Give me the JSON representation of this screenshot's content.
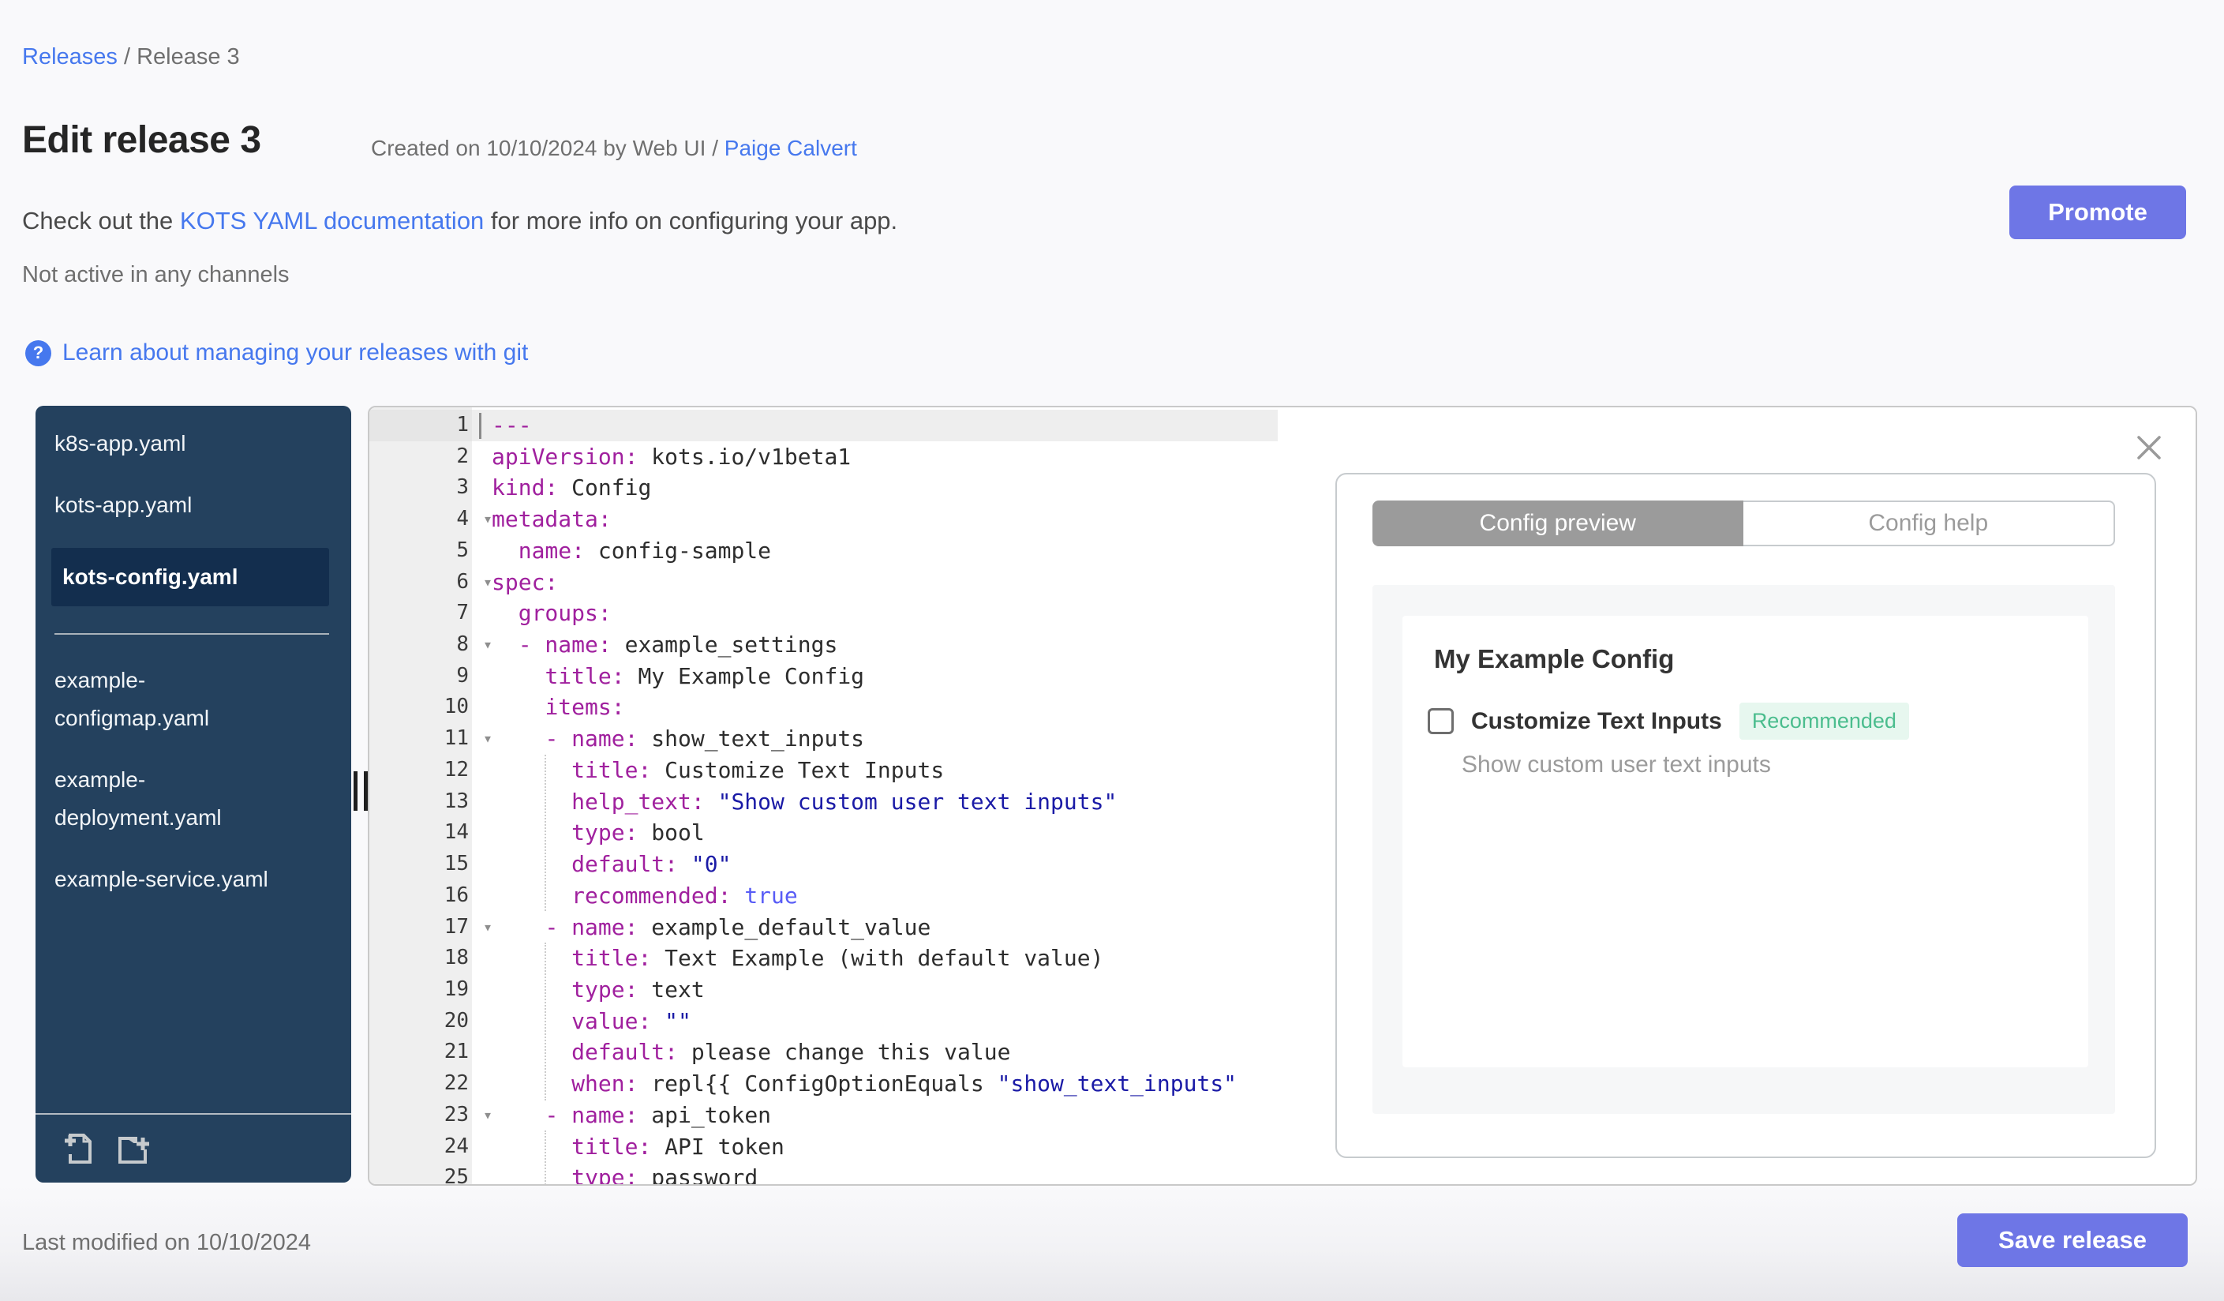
{
  "breadcrumb": {
    "link": "Releases",
    "separator": " / ",
    "current": "Release 3"
  },
  "header": {
    "title": "Edit release 3",
    "created_prefix": "Created on 10/10/2024 by Web UI / ",
    "created_author": "Paige Calvert",
    "docs_prefix": "Check out the ",
    "docs_link": "KOTS YAML documentation",
    "docs_suffix": " for more info on configuring your app.",
    "channel_status": "Not active in any channels",
    "git_link_label": "Learn about managing your releases with git",
    "promote_label": "Promote"
  },
  "icons": {
    "help": "question-mark-circle",
    "close": "x",
    "new_file": "file-plus",
    "new_folder": "folder-plus",
    "fold": "chevron-down",
    "drag_handle": "vertical-bars",
    "question_glyph": "?",
    "fold_glyph": "▾"
  },
  "colors": {
    "accent_button": "#6e76e6",
    "link_blue": "#4678ee",
    "sidebar_bg": "#24415e",
    "sidebar_selected_bg": "#132e4e",
    "badge_text": "#4bbd8e",
    "badge_bg": "#e7f7ef",
    "code_key": "#a0209e",
    "code_string": "#1a1aa6",
    "code_boolean": "#585cf6",
    "tab_active_bg": "#9b9b9b"
  },
  "sidebar": {
    "files": [
      {
        "label": "k8s-app.yaml",
        "lines": [
          "k8s-app.yaml"
        ],
        "selected": false
      },
      {
        "label": "kots-app.yaml",
        "lines": [
          "kots-app.yaml"
        ],
        "selected": false
      },
      {
        "label": "kots-config.yaml",
        "lines": [
          "kots-config.yaml"
        ],
        "selected": true,
        "divider_after": true
      },
      {
        "label": "example-configmap.yaml",
        "lines": [
          "example-",
          "configmap.yaml"
        ],
        "selected": false
      },
      {
        "label": "example-deployment.yaml",
        "lines": [
          "example-",
          "deployment.yaml"
        ],
        "selected": false
      },
      {
        "label": "example-service.yaml",
        "lines": [
          "example-service.yaml"
        ],
        "selected": false
      }
    ]
  },
  "editor": {
    "active_line": 1,
    "lines": [
      {
        "n": 1,
        "fold": false,
        "tokens": [
          [
            "key",
            "---"
          ]
        ]
      },
      {
        "n": 2,
        "fold": false,
        "tokens": [
          [
            "key",
            "apiVersion:"
          ],
          [
            "val",
            " kots.io/v1beta1"
          ]
        ]
      },
      {
        "n": 3,
        "fold": false,
        "tokens": [
          [
            "key",
            "kind:"
          ],
          [
            "val",
            " Config"
          ]
        ]
      },
      {
        "n": 4,
        "fold": true,
        "tokens": [
          [
            "key",
            "metadata:"
          ]
        ]
      },
      {
        "n": 5,
        "fold": false,
        "tokens": [
          [
            "val",
            "  "
          ],
          [
            "key",
            "name:"
          ],
          [
            "val",
            " config-sample"
          ]
        ]
      },
      {
        "n": 6,
        "fold": true,
        "tokens": [
          [
            "key",
            "spec:"
          ]
        ]
      },
      {
        "n": 7,
        "fold": false,
        "tokens": [
          [
            "val",
            "  "
          ],
          [
            "key",
            "groups:"
          ]
        ]
      },
      {
        "n": 8,
        "fold": true,
        "tokens": [
          [
            "val",
            "  "
          ],
          [
            "key",
            "- name:"
          ],
          [
            "val",
            " example_settings"
          ]
        ]
      },
      {
        "n": 9,
        "fold": false,
        "tokens": [
          [
            "val",
            "    "
          ],
          [
            "key",
            "title:"
          ],
          [
            "val",
            " My Example Config"
          ]
        ]
      },
      {
        "n": 10,
        "fold": false,
        "tokens": [
          [
            "val",
            "    "
          ],
          [
            "key",
            "items:"
          ]
        ]
      },
      {
        "n": 11,
        "fold": true,
        "tokens": [
          [
            "val",
            "    "
          ],
          [
            "key",
            "- name:"
          ],
          [
            "val",
            " show_text_inputs"
          ]
        ]
      },
      {
        "n": 12,
        "fold": false,
        "tokens": [
          [
            "val",
            "      "
          ],
          [
            "key",
            "title:"
          ],
          [
            "val",
            " Customize Text Inputs"
          ]
        ]
      },
      {
        "n": 13,
        "fold": false,
        "tokens": [
          [
            "val",
            "      "
          ],
          [
            "key",
            "help_text:"
          ],
          [
            "val",
            " "
          ],
          [
            "str",
            "\"Show custom user text inputs\""
          ]
        ]
      },
      {
        "n": 14,
        "fold": false,
        "tokens": [
          [
            "val",
            "      "
          ],
          [
            "key",
            "type:"
          ],
          [
            "val",
            " bool"
          ]
        ]
      },
      {
        "n": 15,
        "fold": false,
        "tokens": [
          [
            "val",
            "      "
          ],
          [
            "key",
            "default:"
          ],
          [
            "val",
            " "
          ],
          [
            "str",
            "\"0\""
          ]
        ]
      },
      {
        "n": 16,
        "fold": false,
        "tokens": [
          [
            "val",
            "      "
          ],
          [
            "key",
            "recommended:"
          ],
          [
            "val",
            " "
          ],
          [
            "const",
            "true"
          ]
        ]
      },
      {
        "n": 17,
        "fold": true,
        "tokens": [
          [
            "val",
            "    "
          ],
          [
            "key",
            "- name:"
          ],
          [
            "val",
            " example_default_value"
          ]
        ]
      },
      {
        "n": 18,
        "fold": false,
        "tokens": [
          [
            "val",
            "      "
          ],
          [
            "key",
            "title:"
          ],
          [
            "val",
            " Text Example (with default value)"
          ]
        ]
      },
      {
        "n": 19,
        "fold": false,
        "tokens": [
          [
            "val",
            "      "
          ],
          [
            "key",
            "type:"
          ],
          [
            "val",
            " text"
          ]
        ]
      },
      {
        "n": 20,
        "fold": false,
        "tokens": [
          [
            "val",
            "      "
          ],
          [
            "key",
            "value:"
          ],
          [
            "val",
            " "
          ],
          [
            "str",
            "\"\""
          ]
        ]
      },
      {
        "n": 21,
        "fold": false,
        "tokens": [
          [
            "val",
            "      "
          ],
          [
            "key",
            "default:"
          ],
          [
            "val",
            " please change this value"
          ]
        ]
      },
      {
        "n": 22,
        "fold": false,
        "tokens": [
          [
            "val",
            "      "
          ],
          [
            "key",
            "when:"
          ],
          [
            "val",
            " repl{{ ConfigOptionEquals "
          ],
          [
            "str",
            "\"show_text_inputs\""
          ]
        ]
      },
      {
        "n": 23,
        "fold": true,
        "tokens": [
          [
            "val",
            "    "
          ],
          [
            "key",
            "- name:"
          ],
          [
            "val",
            " api_token"
          ]
        ]
      },
      {
        "n": 24,
        "fold": false,
        "tokens": [
          [
            "val",
            "      "
          ],
          [
            "key",
            "title:"
          ],
          [
            "val",
            " API token"
          ]
        ]
      },
      {
        "n": 25,
        "fold": false,
        "tokens": [
          [
            "val",
            "      "
          ],
          [
            "key",
            "type:"
          ],
          [
            "val",
            " password"
          ]
        ]
      }
    ]
  },
  "preview": {
    "tabs": [
      {
        "label": "Config preview",
        "active": true
      },
      {
        "label": "Config help",
        "active": false
      }
    ],
    "group_title": "My Example Config",
    "item": {
      "label": "Customize Text Inputs",
      "badge": "Recommended",
      "help_text": "Show custom user text inputs",
      "checked": false
    }
  },
  "footer": {
    "last_modified": "Last modified on 10/10/2024",
    "save_label": "Save release"
  }
}
